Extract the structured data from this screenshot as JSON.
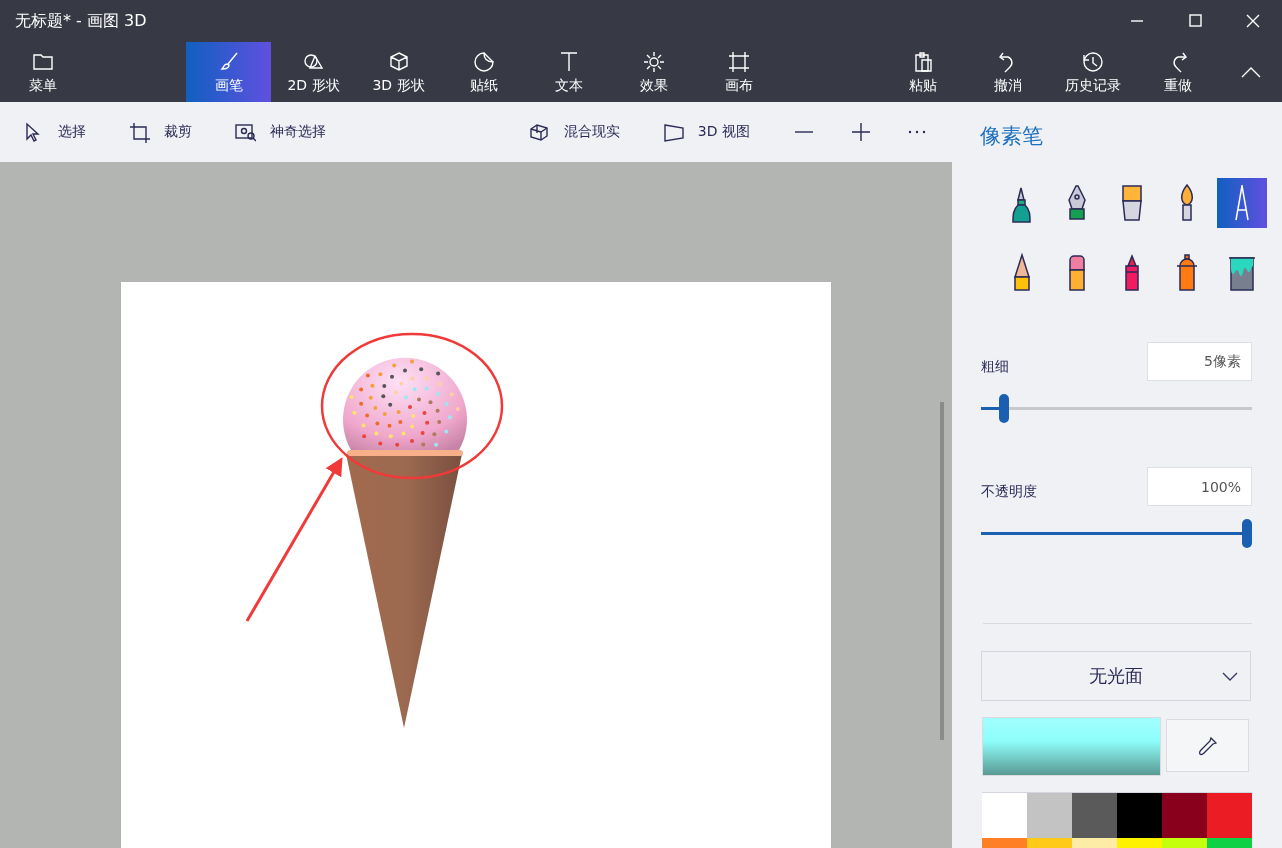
{
  "window": {
    "title": "无标题* - 画图 3D"
  },
  "menu_button": {
    "label": "菜单"
  },
  "tabs": [
    {
      "label": "画笔",
      "kind": "brush",
      "selected": true
    },
    {
      "label": "2D 形状",
      "kind": "shapes2d",
      "selected": false
    },
    {
      "label": "3D 形状",
      "kind": "shapes3d",
      "selected": false
    },
    {
      "label": "贴纸",
      "kind": "sticker",
      "selected": false
    },
    {
      "label": "文本",
      "kind": "text",
      "selected": false
    },
    {
      "label": "效果",
      "kind": "effects",
      "selected": false
    },
    {
      "label": "画布",
      "kind": "canvas",
      "selected": false
    }
  ],
  "ribbon_actions": [
    {
      "label": "粘贴",
      "kind": "paste"
    },
    {
      "label": "撤消",
      "kind": "undo"
    },
    {
      "label": "历史记录",
      "kind": "history"
    },
    {
      "label": "重做",
      "kind": "redo"
    }
  ],
  "toolbar": {
    "left": [
      {
        "label": "选择",
        "kind": "select"
      },
      {
        "label": "裁剪",
        "kind": "crop"
      },
      {
        "label": "神奇选择",
        "kind": "magic"
      }
    ],
    "right": [
      {
        "label": "混合现实",
        "kind": "mixed"
      },
      {
        "label": "3D 视图",
        "kind": "view3d"
      }
    ],
    "zoom": [
      {
        "kind": "zoom-out"
      },
      {
        "kind": "zoom-in"
      },
      {
        "kind": "more"
      }
    ]
  },
  "sidebar": {
    "title": "像素笔",
    "brushes": [
      {
        "kind": "marker",
        "selected": false
      },
      {
        "kind": "calligraphy",
        "selected": false
      },
      {
        "kind": "oil",
        "selected": false
      },
      {
        "kind": "watercolor",
        "selected": false
      },
      {
        "kind": "pixel",
        "selected": true
      },
      {
        "kind": "pencil",
        "selected": false
      },
      {
        "kind": "eraser",
        "selected": false
      },
      {
        "kind": "crayon",
        "selected": false
      },
      {
        "kind": "spray",
        "selected": false
      },
      {
        "kind": "fill",
        "selected": false
      }
    ],
    "sliders": [
      {
        "label": "粗细",
        "value": "5像素",
        "level": 0.07
      },
      {
        "label": "不透明度",
        "value": "100%",
        "level": 1
      }
    ],
    "finish": {
      "value": "无光面"
    },
    "palette": [
      {
        "color": "#ffffff"
      },
      {
        "color": "#c3c3c3"
      },
      {
        "color": "#5a5a5a"
      },
      {
        "color": "#000000"
      },
      {
        "color": "#88001b"
      },
      {
        "color": "#ec1c24"
      },
      {
        "color": "#ff7f27"
      },
      {
        "color": "#ffca18"
      },
      {
        "color": "#fdeca6"
      },
      {
        "color": "#fff200"
      },
      {
        "color": "#c4ff0e"
      },
      {
        "color": "#0ed145"
      }
    ]
  }
}
